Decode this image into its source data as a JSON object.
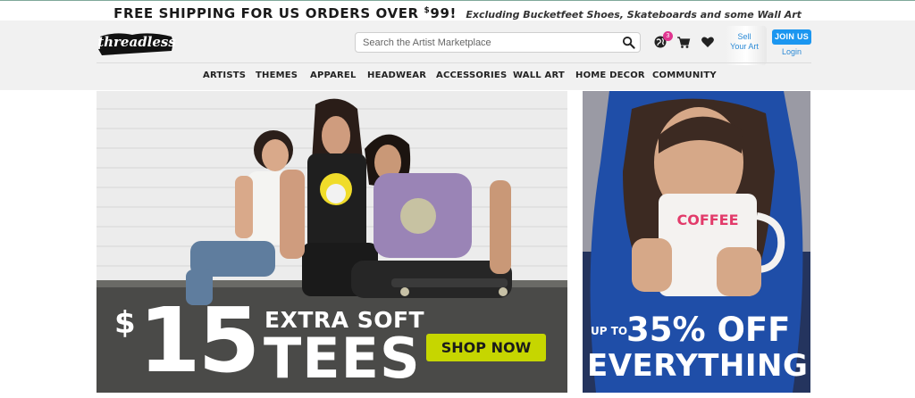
{
  "promo": {
    "main": "FREE SHIPPING FOR US ORDERS OVER",
    "amount_symbol": "$",
    "amount": "99!",
    "sub": "Excluding Bucketfeet Shoes, Skateboards and some Wall Art"
  },
  "header": {
    "logo_text": "threadless",
    "search_placeholder": "Search the Artist Marketplace",
    "notification_count": "3",
    "sell_line1": "Sell",
    "sell_line2": "Your Art",
    "join_label": "JOIN US",
    "login_label": "Login"
  },
  "nav": {
    "items": [
      "ARTISTS",
      "THEMES",
      "APPAREL",
      "HEADWEAR",
      "ACCESSORIES",
      "WALL ART",
      "HOME DECOR",
      "COMMUNITY"
    ]
  },
  "banners": {
    "left": {
      "dollar": "$",
      "amount": "15",
      "line1": "EXTRA SOFT",
      "line2": "TEES",
      "cta": "SHOP NOW"
    },
    "right": {
      "prefix": "UP TO",
      "percent": "35% OFF",
      "line2": "EVERYTHING",
      "mug_text": "COFFEE"
    }
  },
  "colors": {
    "accent_blue": "#1b96f0",
    "link_blue": "#2b8ad6",
    "badge_pink": "#e0358f",
    "cta_lime": "#c6d600"
  },
  "icons": {
    "search": "search-icon",
    "globe": "globe-icon",
    "cart": "cart-icon",
    "heart": "heart-icon"
  }
}
